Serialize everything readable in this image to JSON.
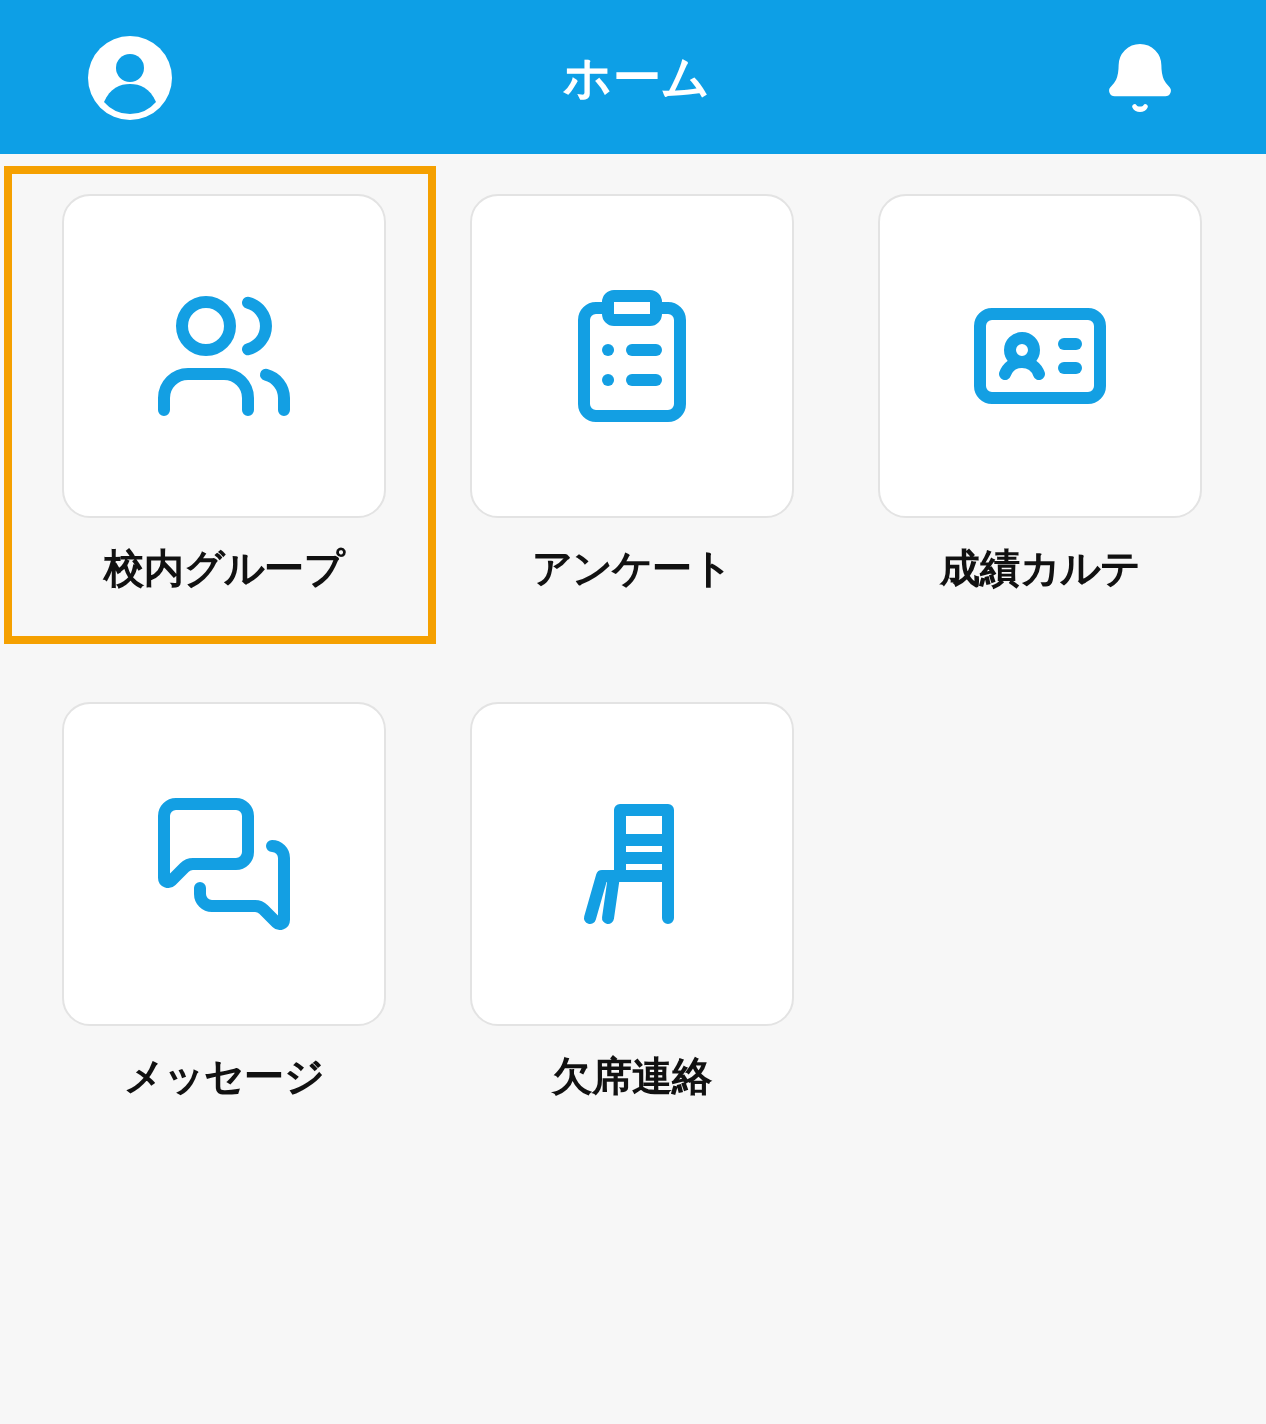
{
  "header": {
    "title": "ホーム"
  },
  "menu": [
    {
      "label": "校内グループ",
      "selected": true
    },
    {
      "label": "アンケート",
      "selected": false
    },
    {
      "label": "成績カルテ",
      "selected": false
    },
    {
      "label": "メッセージ",
      "selected": false
    },
    {
      "label": "欠席連絡",
      "selected": false
    }
  ]
}
